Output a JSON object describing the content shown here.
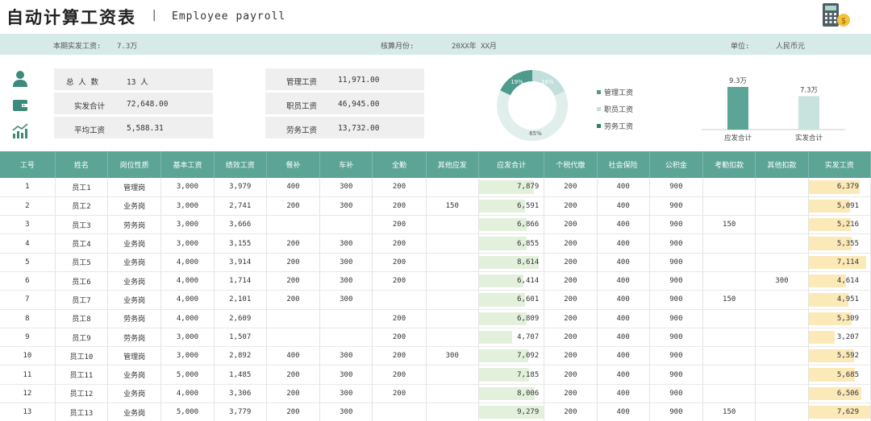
{
  "header": {
    "title": "自动计算工资表",
    "separator": "|",
    "subtitle": "Employee payroll",
    "icon": "calculator-icon"
  },
  "info": {
    "paid_label": "本期实发工资:",
    "paid_value": "7.3万",
    "month_label": "核算月份:",
    "month_value": "20XX年 XX月",
    "unit_label": "单位:",
    "unit_value": "人民币元"
  },
  "summary": {
    "icons": [
      "person-icon",
      "wallet-icon",
      "chart-trend-icon"
    ],
    "left": [
      {
        "label": "总 人 数",
        "value": "13 人"
      },
      {
        "label": "实发合计",
        "value": "72,648.00"
      },
      {
        "label": "平均工资",
        "value": "5,588.31"
      }
    ],
    "right": [
      {
        "label": "管理工资",
        "value": "11,971.00"
      },
      {
        "label": "职员工资",
        "value": "46,945.00"
      },
      {
        "label": "劳务工资",
        "value": "13,732.00"
      }
    ]
  },
  "donut": {
    "labels": [
      "19%",
      "16%",
      "65%"
    ],
    "legend": [
      {
        "label": "管理工资",
        "color": "#4e9a8c"
      },
      {
        "label": "职员工资",
        "color": "#c2dfdb"
      },
      {
        "label": "劳务工资",
        "color": "#2f7d6d"
      }
    ]
  },
  "chart_data": {
    "type": "bar",
    "categories": [
      "应发合计",
      "实发合计"
    ],
    "values": [
      9.3,
      7.3
    ],
    "data_labels": [
      "9.3万",
      "7.3万"
    ],
    "colors": [
      "#5ba496",
      "#c8e3de"
    ]
  },
  "table": {
    "headers": [
      "工号",
      "姓名",
      "岗位性质",
      "基本工资",
      "绩效工资",
      "餐补",
      "车补",
      "全勤",
      "其他应发",
      "应发合计",
      "个税代缴",
      "社会保险",
      "公积金",
      "考勤扣款",
      "其他扣款",
      "实发工资"
    ],
    "rows": [
      [
        "1",
        "员工1",
        "管理岗",
        "3,000",
        "3,979",
        "400",
        "300",
        "200",
        "",
        "7,879",
        "200",
        "400",
        "900",
        "",
        "",
        "6,379"
      ],
      [
        "2",
        "员工2",
        "业务岗",
        "3,000",
        "2,741",
        "200",
        "300",
        "200",
        "150",
        "6,591",
        "200",
        "400",
        "900",
        "",
        "",
        "5,091"
      ],
      [
        "3",
        "员工3",
        "劳务岗",
        "3,000",
        "3,666",
        "",
        "",
        "200",
        "",
        "6,866",
        "200",
        "400",
        "900",
        "150",
        "",
        "5,216"
      ],
      [
        "4",
        "员工4",
        "业务岗",
        "3,000",
        "3,155",
        "200",
        "300",
        "200",
        "",
        "6,855",
        "200",
        "400",
        "900",
        "",
        "",
        "5,355"
      ],
      [
        "5",
        "员工5",
        "业务岗",
        "4,000",
        "3,914",
        "200",
        "300",
        "200",
        "",
        "8,614",
        "200",
        "400",
        "900",
        "",
        "",
        "7,114"
      ],
      [
        "6",
        "员工6",
        "业务岗",
        "4,000",
        "1,714",
        "200",
        "300",
        "200",
        "",
        "6,414",
        "200",
        "400",
        "900",
        "",
        "300",
        "4,614"
      ],
      [
        "7",
        "员工7",
        "业务岗",
        "4,000",
        "2,101",
        "200",
        "300",
        "",
        "",
        "6,601",
        "200",
        "400",
        "900",
        "150",
        "",
        "4,951"
      ],
      [
        "8",
        "员工8",
        "劳务岗",
        "4,000",
        "2,609",
        "",
        "",
        "200",
        "",
        "6,809",
        "200",
        "400",
        "900",
        "",
        "",
        "5,309"
      ],
      [
        "9",
        "员工9",
        "劳务岗",
        "3,000",
        "1,507",
        "",
        "",
        "200",
        "",
        "4,707",
        "200",
        "400",
        "900",
        "",
        "",
        "3,207"
      ],
      [
        "10",
        "员工10",
        "管理岗",
        "3,000",
        "2,892",
        "400",
        "300",
        "200",
        "300",
        "7,092",
        "200",
        "400",
        "900",
        "",
        "",
        "5,592"
      ],
      [
        "11",
        "员工11",
        "业务岗",
        "5,000",
        "1,485",
        "200",
        "300",
        "200",
        "",
        "7,185",
        "200",
        "400",
        "900",
        "",
        "",
        "5,685"
      ],
      [
        "12",
        "员工12",
        "业务岗",
        "4,000",
        "3,306",
        "200",
        "300",
        "200",
        "",
        "8,006",
        "200",
        "400",
        "900",
        "",
        "",
        "6,506"
      ],
      [
        "13",
        "员工13",
        "业务岗",
        "5,000",
        "3,779",
        "200",
        "300",
        "",
        "",
        "9,279",
        "200",
        "400",
        "900",
        "150",
        "",
        "7,629"
      ]
    ]
  }
}
